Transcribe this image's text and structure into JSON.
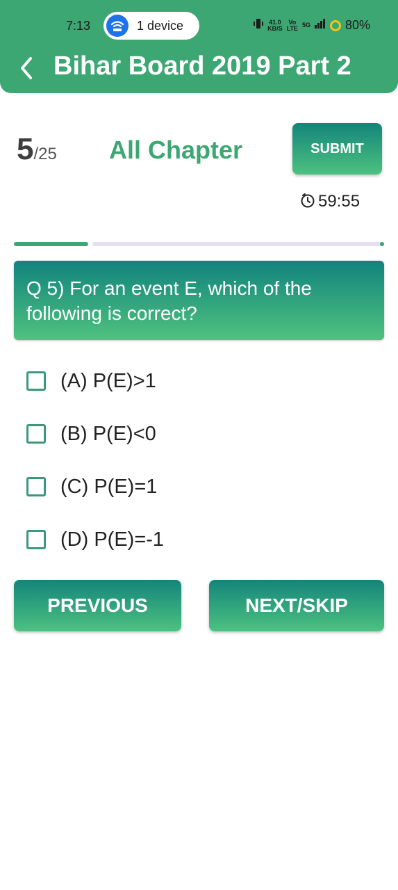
{
  "status_bar": {
    "time": "7:13",
    "device_pill": "1 device",
    "network_speed_value": "41.0",
    "network_speed_unit": "KB/S",
    "volte_top": "Vo",
    "volte_bottom": "LTE",
    "network_type": "5G",
    "battery": "80%"
  },
  "header": {
    "title": "Bihar Board 2019 Part 2"
  },
  "quiz": {
    "current": "5",
    "total": "/25",
    "chapter": "All Chapter",
    "submit_label": "SUBMIT",
    "timer": "59:55",
    "progress_fraction": 0.2
  },
  "question": {
    "text": "Q 5) For an event E, which of the following is correct?"
  },
  "options": [
    {
      "label": "(A) P(E)>1",
      "checked": false
    },
    {
      "label": "(B) P(E)<0",
      "checked": false
    },
    {
      "label": "(C) P(E)=1",
      "checked": false
    },
    {
      "label": "(D) P(E)=-1",
      "checked": false
    }
  ],
  "navigation": {
    "previous_label": "PREVIOUS",
    "next_label": "NEXT/SKIP"
  },
  "colors": {
    "primary": "#3ca772",
    "gradient_top": "#13857a",
    "gradient_bottom": "#4dc180",
    "progress_track": "#e6dff0"
  }
}
